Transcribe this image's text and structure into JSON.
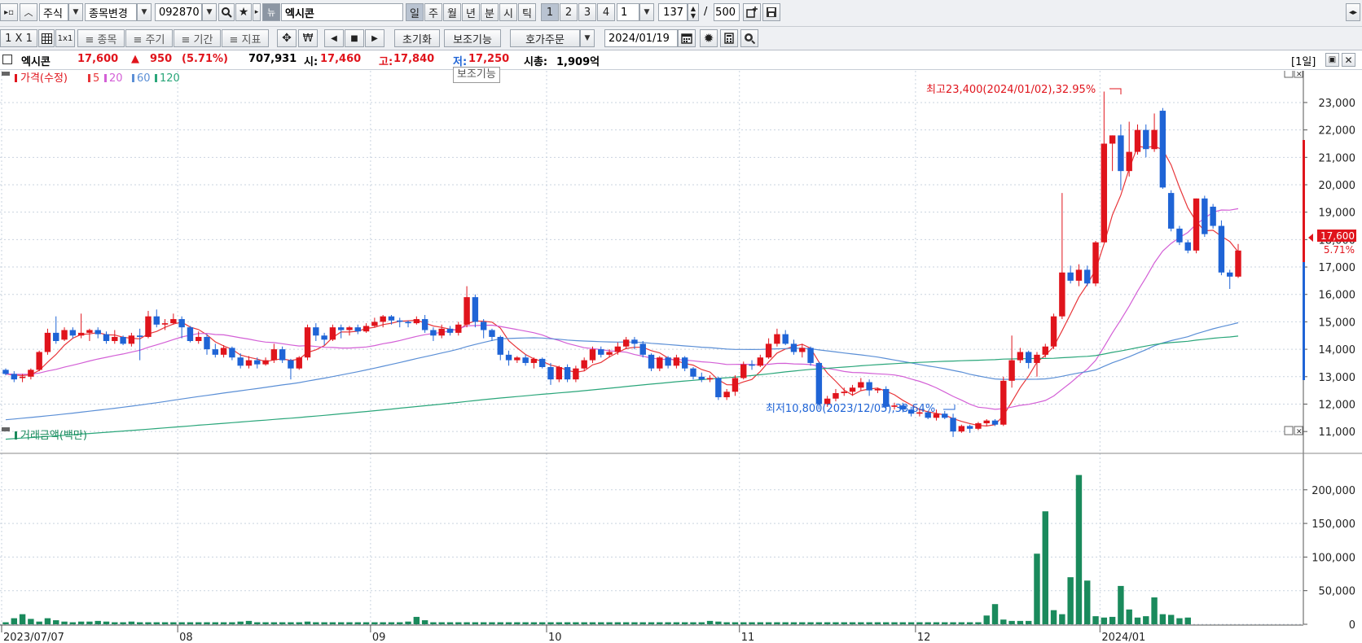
{
  "toolbar1": {
    "market_select": "주식",
    "change_stock_select": "종목변경",
    "stock_code": "092870",
    "news_icon_label": "뉴",
    "stock_name_field": "엑시콘",
    "period_tabs": [
      "일",
      "주",
      "월",
      "년",
      "분",
      "시",
      "틱"
    ],
    "multiplier_tabs": [
      "1",
      "2",
      "3",
      "4"
    ],
    "multiplier_select": "1",
    "count_value": "137",
    "slash": "/",
    "total_value": "500"
  },
  "toolbar2": {
    "layout_label": "1 X 1",
    "tab_label": "1x1",
    "item_button": "≡ 종목",
    "period_button": "≡ 주기",
    "range_button": "≡ 기간",
    "indicator_button": "≡ 지표",
    "reset_button": "초기화",
    "aux_button": "보조기능",
    "order_button": "호가주문",
    "date_value": "2024/01/19"
  },
  "info": {
    "name": "엑시콘",
    "price": "17,600",
    "change_arrow": "▲",
    "change": "950",
    "change_pct": "(5.71%)",
    "volume": "707,931",
    "open_label": "시:",
    "open": "17,460",
    "high_label": "고:",
    "high": "17,840",
    "low_label": "저:",
    "low": "17,250",
    "mcap_label": "시총:",
    "mcap": "1,909억",
    "period_tag": "[1일]"
  },
  "tooltip": "보조기능",
  "price_panel": {
    "legend_title": "가격(수정)",
    "ma_labels": [
      "5",
      "20",
      "60",
      "120"
    ],
    "high_annotation": "최고23,400(2024/01/02),32.95%",
    "low_annotation": "최저10,800(2023/12/05),38.64%",
    "current_price_tag": "17,600",
    "current_pct_tag": "5.71%",
    "axis_labels": [
      "23,000",
      "22,000",
      "21,000",
      "20,000",
      "19,000",
      "18,000",
      "17,000",
      "16,000",
      "15,000",
      "14,000",
      "13,000",
      "12,000",
      "11,000"
    ]
  },
  "volume_panel": {
    "legend_title": "거래금액(백만)",
    "axis_labels": [
      "200,000",
      "150,000",
      "100,000",
      "50,000",
      "0"
    ]
  },
  "x_axis_labels": [
    "2023/07/07",
    "08",
    "09",
    "10",
    "11",
    "12",
    "2024/01"
  ],
  "colors": {
    "up": "#e0141c",
    "down": "#1f64d6",
    "ma5": "#e8363a",
    "ma20": "#d35fd6",
    "ma60": "#5b8fd6",
    "ma120": "#2aa67a",
    "volume": "#1a8a5c",
    "grid": "#c9d3df"
  },
  "chart_data": [
    {
      "type": "candlestick",
      "title": "가격(수정)",
      "x_range": [
        "2023/07/07",
        "2024/01/19"
      ],
      "ylim": [
        10500,
        23800
      ],
      "candles": [
        [
          13250,
          13300,
          13050,
          13100
        ],
        [
          13100,
          13200,
          12800,
          12900
        ],
        [
          12950,
          13100,
          12800,
          13000
        ],
        [
          13000,
          13300,
          12900,
          13250
        ],
        [
          13250,
          13950,
          13200,
          13900
        ],
        [
          13900,
          14750,
          13800,
          14600
        ],
        [
          14600,
          15200,
          14200,
          14300
        ],
        [
          14350,
          14800,
          14300,
          14700
        ],
        [
          14700,
          14800,
          14400,
          14500
        ],
        [
          14500,
          15300,
          14400,
          14600
        ],
        [
          14600,
          14750,
          14300,
          14700
        ],
        [
          14700,
          14800,
          14400,
          14550
        ],
        [
          14550,
          14650,
          14200,
          14300
        ],
        [
          14300,
          14700,
          14200,
          14450
        ],
        [
          14450,
          14500,
          14150,
          14200
        ],
        [
          14200,
          14600,
          14100,
          14500
        ],
        [
          14500,
          14750,
          13600,
          14450
        ],
        [
          14450,
          15400,
          14400,
          15200
        ],
        [
          15200,
          15450,
          14800,
          14900
        ],
        [
          14900,
          15100,
          14700,
          14950
        ],
        [
          14950,
          15300,
          14900,
          15100
        ],
        [
          15100,
          15200,
          14400,
          14800
        ],
        [
          14800,
          14850,
          14250,
          14300
        ],
        [
          14300,
          14650,
          14200,
          14450
        ],
        [
          14450,
          14550,
          13800,
          14000
        ],
        [
          14000,
          14200,
          13700,
          13800
        ],
        [
          13800,
          14150,
          13700,
          14050
        ],
        [
          14050,
          14100,
          13600,
          13700
        ],
        [
          13700,
          13850,
          13300,
          13400
        ],
        [
          13400,
          13750,
          13300,
          13600
        ],
        [
          13600,
          13700,
          13300,
          13450
        ],
        [
          13450,
          13700,
          13400,
          13600
        ],
        [
          13600,
          14200,
          13500,
          14000
        ],
        [
          14000,
          14100,
          13500,
          13600
        ],
        [
          13600,
          13650,
          12900,
          13300
        ],
        [
          13300,
          13750,
          13250,
          13700
        ],
        [
          13700,
          14900,
          13600,
          14800
        ],
        [
          14800,
          14950,
          14300,
          14500
        ],
        [
          14500,
          14600,
          14150,
          14350
        ],
        [
          14350,
          14900,
          14300,
          14800
        ],
        [
          14800,
          14900,
          14400,
          14700
        ],
        [
          14700,
          14850,
          14500,
          14800
        ],
        [
          14800,
          14900,
          14550,
          14650
        ],
        [
          14650,
          14950,
          14600,
          14850
        ],
        [
          14850,
          15150,
          14800,
          15000
        ],
        [
          15000,
          15250,
          14800,
          15200
        ],
        [
          15200,
          15250,
          14900,
          15050
        ],
        [
          15050,
          15150,
          14800,
          15000
        ],
        [
          15000,
          15050,
          14800,
          14950
        ],
        [
          14950,
          15200,
          14900,
          15100
        ],
        [
          15100,
          15250,
          14600,
          14700
        ],
        [
          14700,
          14800,
          14300,
          14500
        ],
        [
          14500,
          14900,
          14400,
          14750
        ],
        [
          14750,
          14850,
          14500,
          14600
        ],
        [
          14600,
          15000,
          14500,
          14900
        ],
        [
          14900,
          16300,
          14800,
          15900
        ],
        [
          15900,
          16000,
          14800,
          15000
        ],
        [
          15000,
          15100,
          14400,
          14700
        ],
        [
          14700,
          14750,
          14300,
          14450
        ],
        [
          14450,
          14500,
          13600,
          13800
        ],
        [
          13800,
          13950,
          13400,
          13600
        ],
        [
          13600,
          13750,
          13500,
          13700
        ],
        [
          13700,
          13800,
          13400,
          13500
        ],
        [
          13500,
          13700,
          13300,
          13650
        ],
        [
          13650,
          13700,
          13300,
          13350
        ],
        [
          13350,
          13500,
          12700,
          12900
        ],
        [
          12900,
          13400,
          12800,
          13350
        ],
        [
          13350,
          13450,
          12800,
          12900
        ],
        [
          12900,
          13400,
          12800,
          13300
        ],
        [
          13300,
          13700,
          13200,
          13600
        ],
        [
          13600,
          14100,
          13500,
          14000
        ],
        [
          14000,
          14100,
          13700,
          13800
        ],
        [
          13800,
          14000,
          13700,
          13900
        ],
        [
          13900,
          14250,
          13800,
          14100
        ],
        [
          14100,
          14450,
          14000,
          14350
        ],
        [
          14350,
          14450,
          14000,
          14200
        ],
        [
          14200,
          14300,
          13700,
          13800
        ],
        [
          13800,
          13850,
          13200,
          13300
        ],
        [
          13300,
          13750,
          13200,
          13700
        ],
        [
          13700,
          13750,
          13300,
          13400
        ],
        [
          13400,
          13800,
          13300,
          13700
        ],
        [
          13700,
          13750,
          13200,
          13300
        ],
        [
          13300,
          13350,
          12900,
          13000
        ],
        [
          13000,
          13150,
          12800,
          12900
        ],
        [
          12900,
          13050,
          12800,
          12950
        ],
        [
          12950,
          13000,
          12150,
          12250
        ],
        [
          12250,
          12550,
          12150,
          12450
        ],
        [
          12450,
          13050,
          12300,
          12950
        ],
        [
          12950,
          13550,
          12900,
          13450
        ],
        [
          13450,
          13600,
          13250,
          13400
        ],
        [
          13400,
          13800,
          13350,
          13700
        ],
        [
          13700,
          14400,
          13650,
          14200
        ],
        [
          14200,
          14750,
          14100,
          14550
        ],
        [
          14550,
          14700,
          14150,
          14200
        ],
        [
          14200,
          14350,
          13800,
          13900
        ],
        [
          13900,
          14200,
          13700,
          14050
        ],
        [
          14050,
          14100,
          13400,
          13500
        ],
        [
          13500,
          13550,
          11800,
          12000
        ],
        [
          12000,
          12300,
          11900,
          12200
        ],
        [
          12200,
          12550,
          12100,
          12400
        ],
        [
          12400,
          12600,
          12300,
          12450
        ],
        [
          12450,
          12700,
          12300,
          12600
        ],
        [
          12600,
          12950,
          12500,
          12800
        ],
        [
          12800,
          12900,
          12300,
          12500
        ],
        [
          12500,
          12600,
          12400,
          12550
        ],
        [
          12550,
          12650,
          11800,
          11900
        ],
        [
          11900,
          12050,
          11800,
          11950
        ],
        [
          11950,
          12050,
          11700,
          11800
        ],
        [
          11800,
          11900,
          11550,
          11650
        ],
        [
          11650,
          11850,
          11550,
          11700
        ],
        [
          11700,
          11750,
          11450,
          11500
        ],
        [
          11500,
          11800,
          11400,
          11650
        ],
        [
          11650,
          11750,
          11450,
          11500
        ],
        [
          11500,
          11650,
          10800,
          11000
        ],
        [
          11000,
          11250,
          10950,
          11200
        ],
        [
          11200,
          11250,
          10950,
          11100
        ],
        [
          11100,
          11350,
          11050,
          11300
        ],
        [
          11300,
          11450,
          11200,
          11400
        ],
        [
          11400,
          11450,
          11200,
          11250
        ],
        [
          11250,
          13000,
          11200,
          12850
        ],
        [
          12850,
          14500,
          12600,
          13600
        ],
        [
          13600,
          14050,
          13500,
          13900
        ],
        [
          13900,
          13950,
          13300,
          13500
        ],
        [
          13500,
          13900,
          13000,
          13800
        ],
        [
          13800,
          14200,
          13700,
          14100
        ],
        [
          14100,
          15300,
          14000,
          15200
        ],
        [
          15200,
          19700,
          15100,
          16800
        ],
        [
          16800,
          17050,
          16400,
          16500
        ],
        [
          16500,
          17100,
          16300,
          16900
        ],
        [
          16900,
          17050,
          16300,
          16400
        ],
        [
          16400,
          17950,
          16300,
          17900
        ],
        [
          17900,
          23400,
          20000,
          21500
        ],
        [
          21500,
          21800,
          20500,
          21800
        ],
        [
          21800,
          22200,
          19800,
          20500
        ],
        [
          20500,
          22300,
          20300,
          21200
        ],
        [
          21200,
          22200,
          21100,
          22000
        ],
        [
          22000,
          22200,
          21000,
          21300
        ],
        [
          21300,
          22600,
          21200,
          22000
        ],
        [
          22700,
          22800,
          19850,
          19900
        ],
        [
          19700,
          19800,
          18300,
          18400
        ],
        [
          18400,
          18500,
          17800,
          17900
        ],
        [
          17900,
          18000,
          17500,
          17600
        ],
        [
          17600,
          19500,
          17500,
          19500
        ],
        [
          19500,
          19600,
          18100,
          18200
        ],
        [
          19200,
          19300,
          18400,
          18500
        ],
        [
          18500,
          18700,
          16700,
          16800
        ],
        [
          16800,
          16900,
          16200,
          16650
        ],
        [
          16650,
          17840,
          16600,
          17600
        ]
      ]
    },
    {
      "type": "bar",
      "title": "거래금액(백만)",
      "ylim": [
        0,
        230000
      ],
      "values": [
        3000,
        9000,
        15000,
        8000,
        4000,
        9000,
        6000,
        4000,
        3000,
        4000,
        4000,
        5000,
        4000,
        3000,
        3000,
        4000,
        3000,
        3000,
        3000,
        3000,
        3000,
        3000,
        3000,
        3000,
        3000,
        3000,
        3000,
        3000,
        4000,
        5000,
        3000,
        3000,
        3000,
        3000,
        3000,
        3000,
        4000,
        3000,
        3000,
        3000,
        3000,
        3000,
        3000,
        3000,
        3000,
        3000,
        3000,
        3000,
        4000,
        11000,
        6000,
        3000,
        3000,
        3000,
        3000,
        3000,
        3000,
        3000,
        3000,
        3000,
        3000,
        3000,
        3000,
        3000,
        3000,
        3000,
        3000,
        3000,
        3000,
        3000,
        3000,
        3000,
        3000,
        3000,
        3000,
        3000,
        3000,
        3000,
        3000,
        3000,
        3000,
        3000,
        3000,
        3000,
        5000,
        4000,
        3000,
        3000,
        3000,
        3000,
        3000,
        3000,
        3000,
        3000,
        3000,
        3000,
        3000,
        3000,
        3000,
        3000,
        3000,
        3000,
        3000,
        3000,
        3000,
        3000,
        3000,
        3000,
        3000,
        3000,
        3000,
        3000,
        3000,
        3000,
        3000,
        3000,
        3000,
        13000,
        30000,
        7000,
        5000,
        5000,
        5000,
        105000,
        168000,
        21000,
        15000,
        70000,
        222000,
        65000,
        12000,
        10000,
        11000,
        57000,
        22000,
        10000,
        12000,
        40000,
        15000,
        14000,
        9000,
        10000
      ]
    }
  ]
}
